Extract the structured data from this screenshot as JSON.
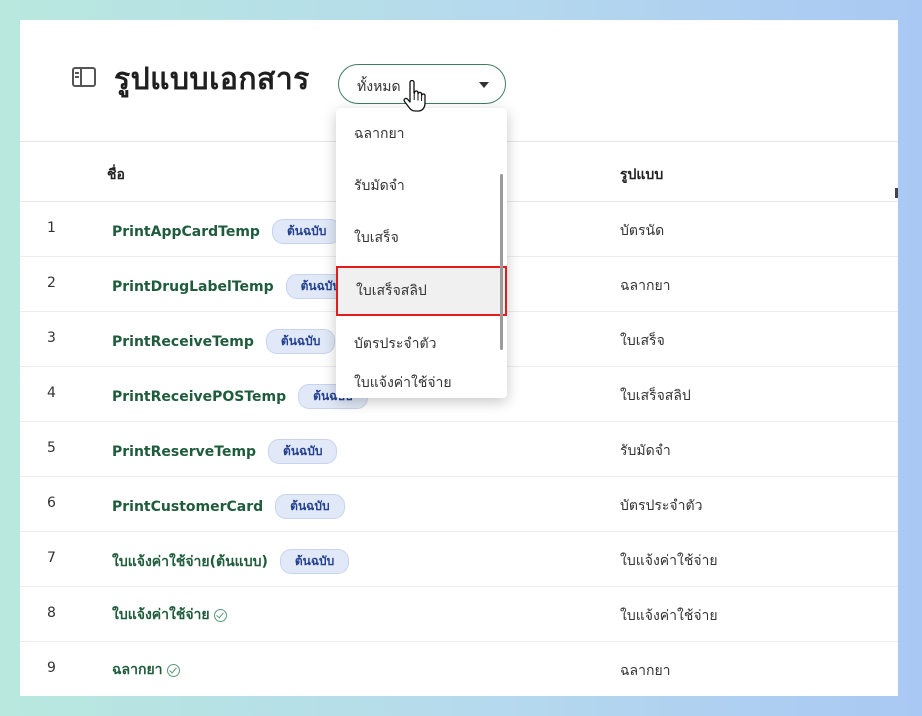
{
  "page": {
    "title": "รูปแบบเอกสาร",
    "panel_icon": "sidebar-panel-icon"
  },
  "filter": {
    "value": "ทั้งหมด",
    "caret_icon": "caret-down-icon"
  },
  "dropdown": {
    "options": [
      {
        "label": "ฉลากยา"
      },
      {
        "label": "รับมัดจำ"
      },
      {
        "label": "ใบเสร็จ"
      },
      {
        "label": "ใบเสร็จสลิป",
        "highlighted": true
      },
      {
        "label": "บัตรประจำตัว"
      },
      {
        "label": "ใบแจ้งค่าใช้จ่าย"
      }
    ]
  },
  "table": {
    "columns": {
      "name": "ชื่อ",
      "type": "รูปแบบ"
    },
    "rows": [
      {
        "no": "1",
        "name": "PrintAppCardTemp",
        "badge": "ต้นฉบับ",
        "type": "บัตรนัด"
      },
      {
        "no": "2",
        "name": "PrintDrugLabelTemp",
        "badge": "ต้นฉบับ",
        "type": "ฉลากยา"
      },
      {
        "no": "3",
        "name": "PrintReceiveTemp",
        "badge": "ต้นฉบับ",
        "type": "ใบเสร็จ"
      },
      {
        "no": "4",
        "name": "PrintReceivePOSTemp",
        "badge": "ต้นฉบับ",
        "type": "ใบเสร็จสลิป"
      },
      {
        "no": "5",
        "name": "PrintReserveTemp",
        "badge": "ต้นฉบับ",
        "type": "รับมัดจำ"
      },
      {
        "no": "6",
        "name": "PrintCustomerCard",
        "badge": "ต้นฉบับ",
        "type": "บัตรประจำตัว"
      },
      {
        "no": "7",
        "name": "ใบแจ้งค่าใช้จ่าย(ต้นแบบ)",
        "badge": "ต้นฉบับ",
        "type": "ใบแจ้งค่าใช้จ่าย"
      },
      {
        "no": "8",
        "name": "ใบแจ้งค่าใช้จ่าย",
        "check": "check-circle-icon",
        "type": "ใบแจ้งค่าใช้จ่าย"
      },
      {
        "no": "9",
        "name": "ฉลากยา",
        "check": "check-circle-icon",
        "type": "ฉลากยา"
      }
    ]
  },
  "colors": {
    "accent": "#3f7d5f",
    "name_text": "#1f5c3c",
    "badge_text": "#23408e",
    "badge_bg": "#e1e9f8",
    "highlight_border": "#e31b1b"
  }
}
